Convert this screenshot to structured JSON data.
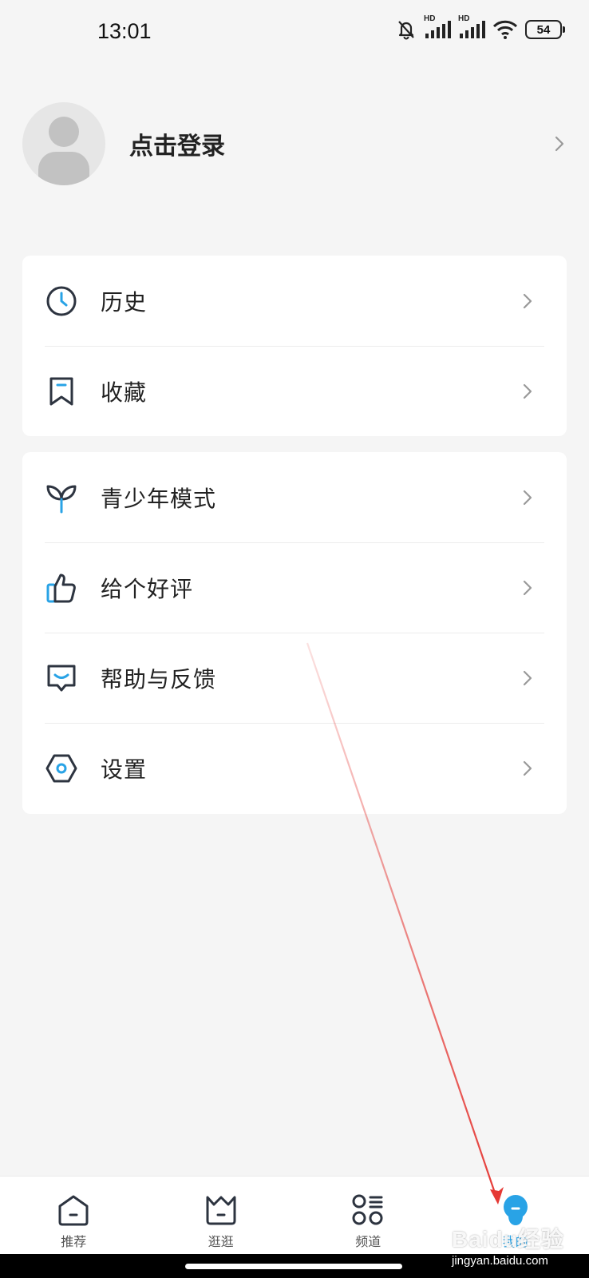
{
  "status_bar": {
    "time": "13:01",
    "battery": "54",
    "signal_label": "HD",
    "icons": [
      "mute-bell-icon",
      "hd-signal-icon",
      "hd-signal-icon",
      "wifi-icon",
      "battery-icon"
    ]
  },
  "profile": {
    "login_label": "点击登录",
    "avatar_icon": "default-avatar-icon"
  },
  "menu_group_1": [
    {
      "label": "历史",
      "icon": "clock-icon"
    },
    {
      "label": "收藏",
      "icon": "bookmark-icon"
    }
  ],
  "menu_group_2": [
    {
      "label": "青少年模式",
      "icon": "sprout-icon"
    },
    {
      "label": "给个好评",
      "icon": "thumbs-up-icon"
    },
    {
      "label": "帮助与反馈",
      "icon": "feedback-bubble-icon"
    },
    {
      "label": "设置",
      "icon": "hexagon-gear-icon"
    }
  ],
  "tabbar": {
    "tabs": [
      {
        "label": "推荐",
        "icon": "home-icon",
        "active": false
      },
      {
        "label": "逛逛",
        "icon": "basket-icon",
        "active": false
      },
      {
        "label": "频道",
        "icon": "channels-grid-icon",
        "active": false
      },
      {
        "label": "我的",
        "icon": "profile-face-icon",
        "active": true
      }
    ]
  },
  "watermark": {
    "logo": "Baidu经验",
    "site": "jingyan.baidu.com"
  },
  "colors": {
    "accent": "#29a3e6",
    "annotation_arrow": "#e53935",
    "background": "#f5f5f5"
  }
}
